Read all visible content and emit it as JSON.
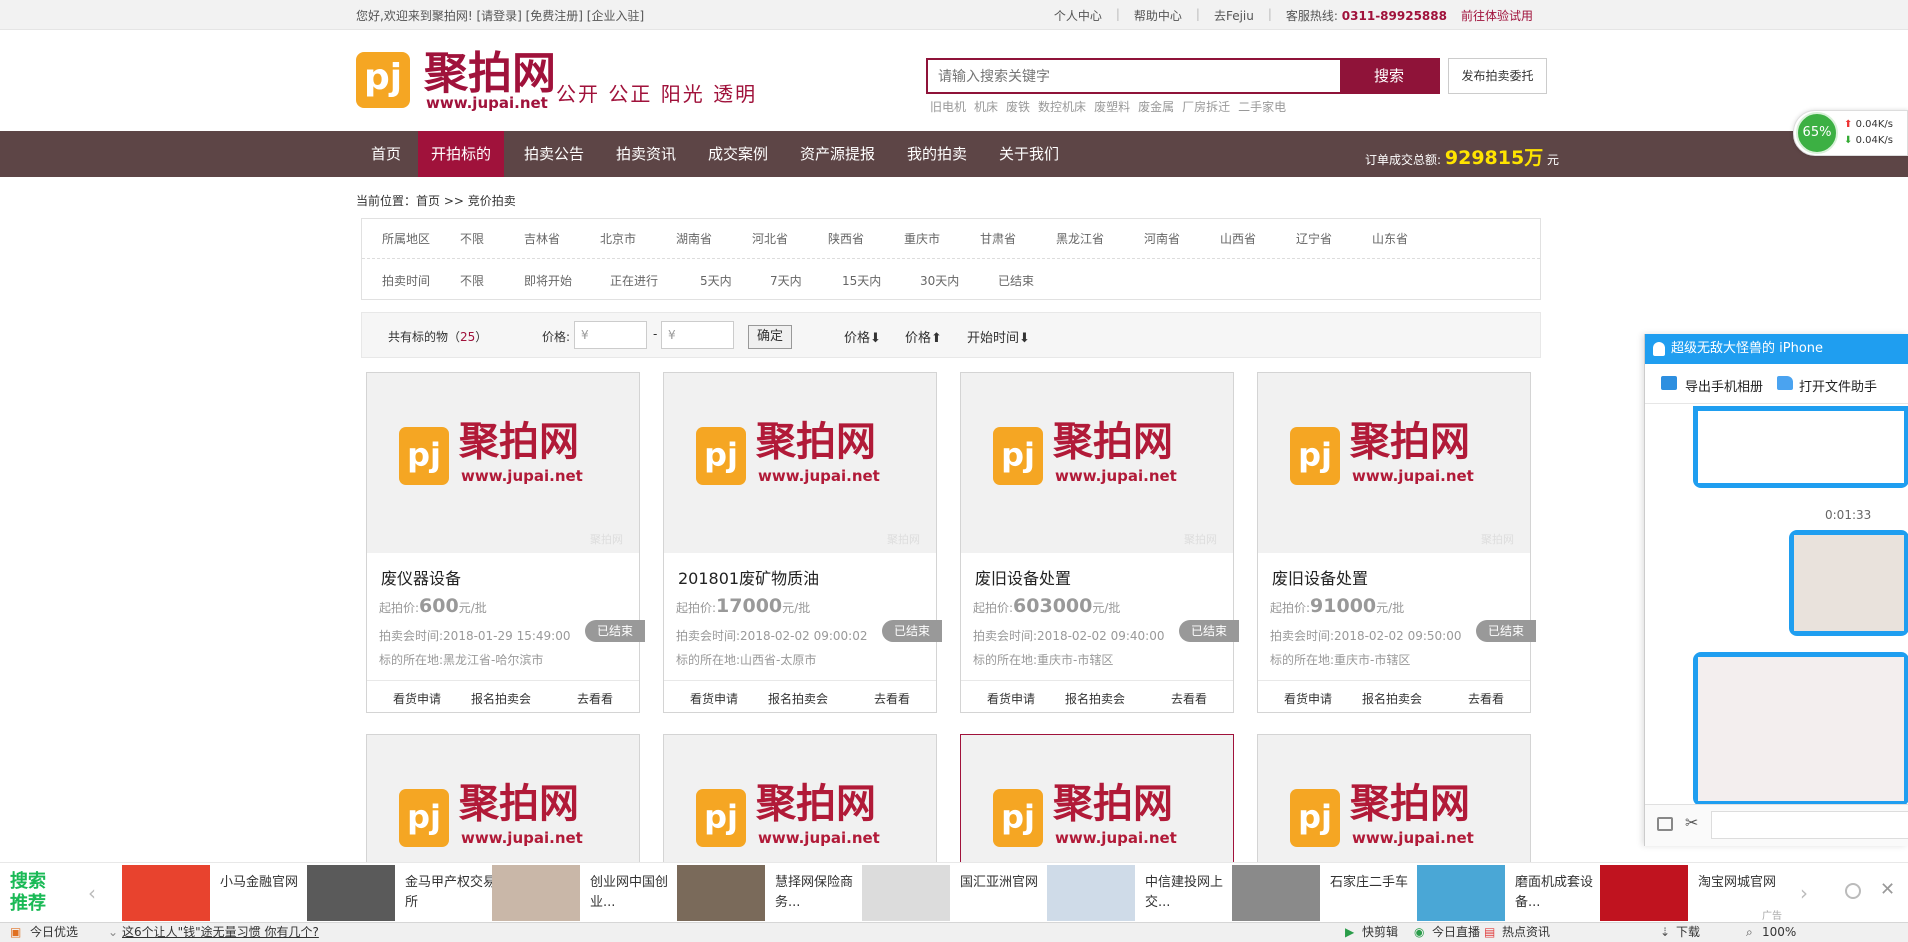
{
  "topbar": {
    "welcome": "您好,欢迎来到聚拍网! [请登录] [免费注册] [企业入驻]",
    "links": [
      "个人中心",
      "帮助中心",
      "去Fejiu"
    ],
    "hotline_label": "客服热线:",
    "hotline": "0311-89925888",
    "trial": "前往体验试用"
  },
  "header": {
    "logo_mark": "pj",
    "logo_name": "聚拍网",
    "logo_url": "www.jupai.net",
    "slogan": "公开 公正 阳光 透明",
    "search_placeholder": "请输入搜索关键字",
    "search_button": "搜索",
    "publish_button": "发布拍卖委托",
    "hotwords": [
      "旧电机",
      "机床",
      "废铁",
      "数控机床",
      "废塑料",
      "废金属",
      "厂房拆迁",
      "二手家电"
    ]
  },
  "nav": {
    "items": [
      "首页",
      "开拍标的",
      "拍卖公告",
      "拍卖资讯",
      "成交案例",
      "资产源提报",
      "我的拍卖",
      "关于我们"
    ],
    "active_index": 1,
    "total_label": "订单成交总额:",
    "total_value": "929815万",
    "total_unit": "元"
  },
  "speed_widget": {
    "percent": "65%",
    "up": "0.04K/s",
    "down": "0.04K/s"
  },
  "breadcrumb": "当前位置：首页 >> 竞价拍卖",
  "filter": {
    "region_label": "所属地区",
    "regions": [
      "不限",
      "吉林省",
      "北京市",
      "湖南省",
      "河北省",
      "陕西省",
      "重庆市",
      "甘肃省",
      "黑龙江省",
      "河南省",
      "山西省",
      "辽宁省",
      "山东省"
    ],
    "time_label": "拍卖时间",
    "times": [
      "不限",
      "即将开始",
      "正在进行",
      "5天内",
      "7天内",
      "15天内",
      "30天内",
      "已结束"
    ]
  },
  "sortbar": {
    "count_prefix": "共有标的物（",
    "count": "25",
    "count_suffix": "）",
    "price_label": "价格:",
    "price_placeholder": "¥",
    "dash": "-",
    "confirm": "确定",
    "sorts": [
      "价格⬇",
      "价格⬆",
      "开始时间⬇"
    ]
  },
  "cards": [
    {
      "title": "废仪器设备",
      "price_label": "起拍价:",
      "price": "600",
      "price_unit": "元/批",
      "time": "拍卖会时间:2018-01-29 15:49:00",
      "location": "标的所在地:黑龙江省-哈尔滨市",
      "status": "已结束"
    },
    {
      "title": "201801废矿物质油",
      "price_label": "起拍价:",
      "price": "17000",
      "price_unit": "元/批",
      "time": "拍卖会时间:2018-02-02 09:00:02",
      "location": "标的所在地:山西省-太原市",
      "status": "已结束"
    },
    {
      "title": "废旧设备处置",
      "price_label": "起拍价:",
      "price": "603000",
      "price_unit": "元/批",
      "time": "拍卖会时间:2018-02-02 09:40:00",
      "location": "标的所在地:重庆市-市辖区",
      "status": "已结束"
    },
    {
      "title": "废旧设备处置",
      "price_label": "起拍价:",
      "price": "91000",
      "price_unit": "元/批",
      "time": "拍卖会时间:2018-02-02 09:50:00",
      "location": "标的所在地:重庆市-市辖区",
      "status": "已结束"
    }
  ],
  "card_actions": [
    "看货申请",
    "报名拍卖会",
    "去看看"
  ],
  "card_logo": {
    "mark": "pj",
    "name": "聚拍网",
    "url": "www.jupai.net",
    "watermark": "聚拍网"
  },
  "qq_panel": {
    "title": "超级无敌大怪兽的 iPhone",
    "tool1": "导出手机相册",
    "tool2": "打开文件助手",
    "timestamp": "0:01:33"
  },
  "adbar": {
    "tag": "搜索推荐",
    "ads": [
      {
        "text": "小马金融官网",
        "color": "#e8432e"
      },
      {
        "text": "金马甲产权交易所",
        "color": "#5a5a5a"
      },
      {
        "text": "创业网中国创业...",
        "color": "#c9b7a8"
      },
      {
        "text": "慧择网保险商务...",
        "color": "#7a6a5a"
      },
      {
        "text": "国汇亚洲官网",
        "color": "#dcdcdc"
      },
      {
        "text": "中信建投网上交...",
        "color": "#cfdbe8"
      },
      {
        "text": "石家庄二手车",
        "color": "#8a8a8a"
      },
      {
        "text": "磨面机成套设备...",
        "color": "#4aa7d6"
      },
      {
        "text": "淘宝网城官网",
        "color": "#c0131f"
      }
    ],
    "ad_label": "广告"
  },
  "statusbar": {
    "left": "今日优选",
    "news": "这6个让人\"钱\"途无量习惯 你有几个?",
    "right": [
      "快剪辑",
      "今日直播",
      "热点资讯",
      "下载",
      "100%"
    ]
  },
  "colors": {
    "brand": "#a0123b",
    "nav_bg": "#5d4546",
    "logo_orange": "#f5a623"
  }
}
